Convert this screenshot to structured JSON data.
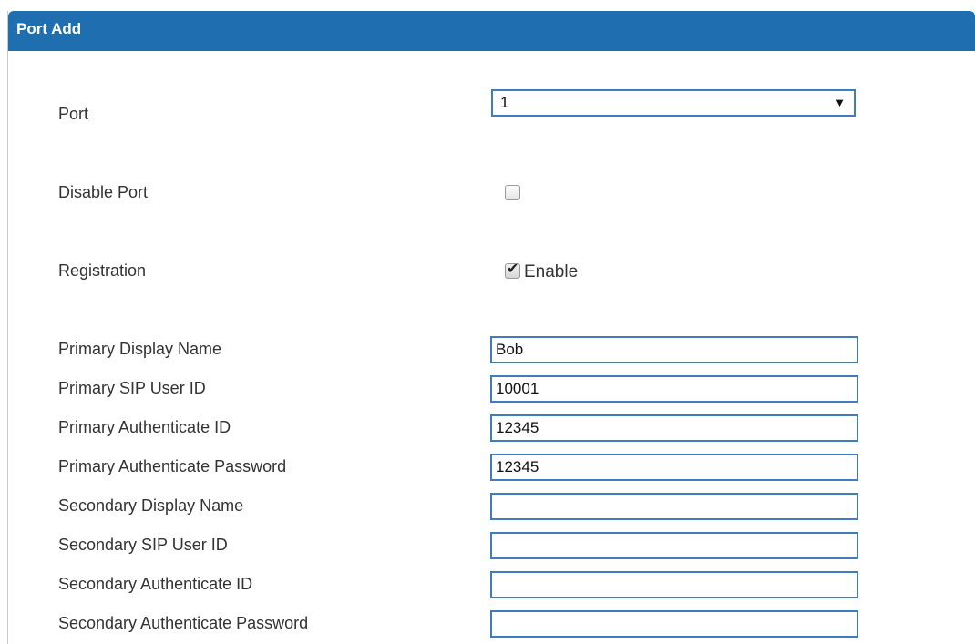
{
  "header": {
    "title": "Port Add"
  },
  "port": {
    "label": "Port",
    "value": "1"
  },
  "disable_port": {
    "label": "Disable Port",
    "checked": false
  },
  "registration": {
    "label": "Registration",
    "checked": true,
    "option_label": "Enable"
  },
  "fields": [
    {
      "label": "Primary Display Name",
      "value": "Bob"
    },
    {
      "label": "Primary SIP User ID",
      "value": "10001"
    },
    {
      "label": "Primary Authenticate ID",
      "value": "12345"
    },
    {
      "label": "Primary Authenticate Password",
      "value": "12345"
    },
    {
      "label": "Secondary Display Name",
      "value": ""
    },
    {
      "label": "Secondary SIP User ID",
      "value": ""
    },
    {
      "label": "Secondary Authenticate ID",
      "value": ""
    },
    {
      "label": "Secondary Authenticate Password",
      "value": ""
    }
  ],
  "colors": {
    "header_background": "#1f6fb0",
    "input_border": "#3f7cc0"
  }
}
